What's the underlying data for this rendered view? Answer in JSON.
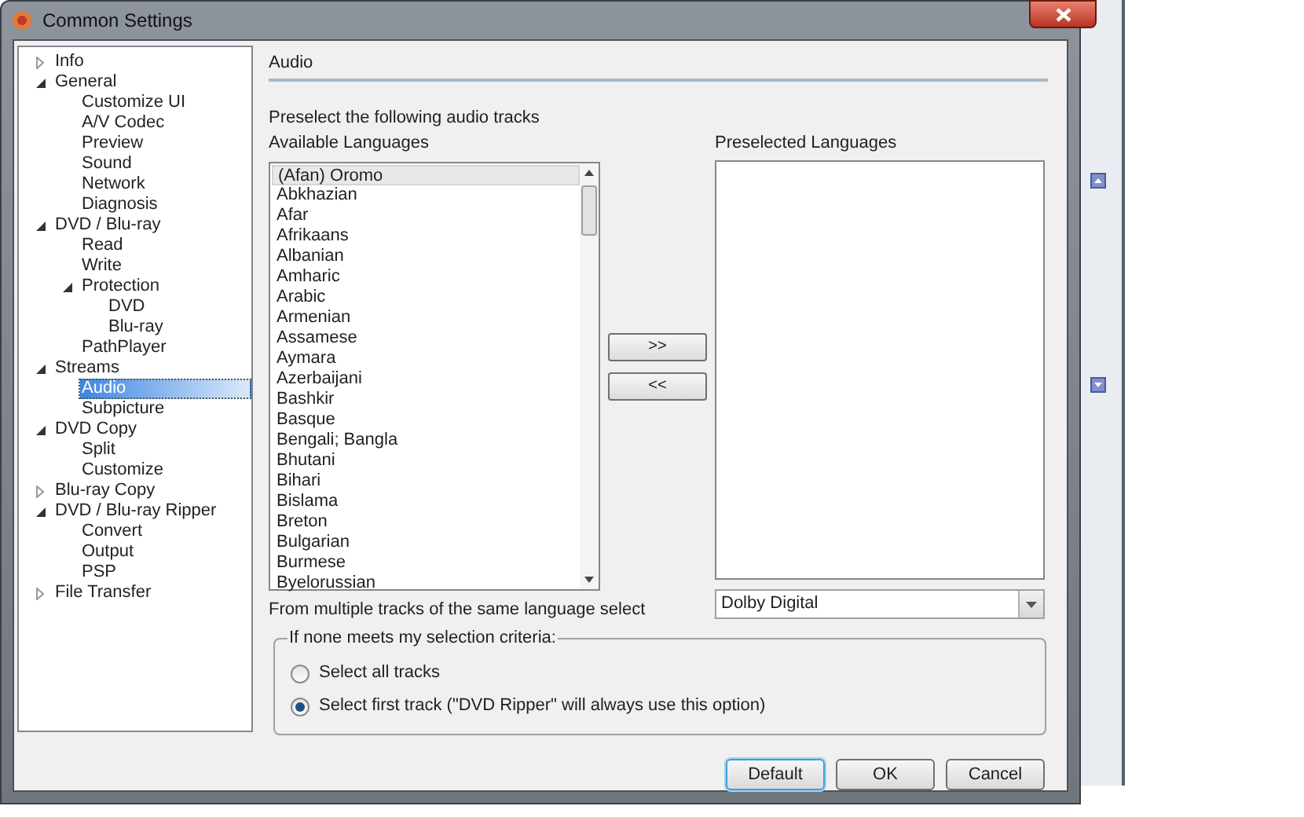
{
  "window": {
    "title": "Common Settings"
  },
  "tree": [
    {
      "label": "Info",
      "expanded": false,
      "selected": false
    },
    {
      "label": "General",
      "expanded": true,
      "selected": false,
      "children": [
        {
          "label": "Customize UI",
          "selected": false
        },
        {
          "label": "A/V Codec",
          "selected": false
        },
        {
          "label": "Preview",
          "selected": false
        },
        {
          "label": "Sound",
          "selected": false
        },
        {
          "label": "Network",
          "selected": false
        },
        {
          "label": "Diagnosis",
          "selected": false
        }
      ]
    },
    {
      "label": "DVD / Blu-ray",
      "expanded": true,
      "selected": false,
      "children": [
        {
          "label": "Read",
          "selected": false
        },
        {
          "label": "Write",
          "selected": false
        },
        {
          "label": "Protection",
          "expanded": true,
          "selected": false,
          "children": [
            {
              "label": "DVD",
              "selected": false
            },
            {
              "label": "Blu-ray",
              "selected": false
            }
          ]
        },
        {
          "label": "PathPlayer",
          "selected": false
        }
      ]
    },
    {
      "label": "Streams",
      "expanded": true,
      "selected": false,
      "children": [
        {
          "label": "Audio",
          "selected": true
        },
        {
          "label": "Subpicture",
          "selected": false
        }
      ]
    },
    {
      "label": "DVD Copy",
      "expanded": true,
      "selected": false,
      "children": [
        {
          "label": "Split",
          "selected": false
        },
        {
          "label": "Customize",
          "selected": false
        }
      ]
    },
    {
      "label": "Blu-ray Copy",
      "expanded": false,
      "selected": false
    },
    {
      "label": "DVD / Blu-ray Ripper",
      "expanded": true,
      "selected": false,
      "children": [
        {
          "label": "Convert",
          "selected": false
        },
        {
          "label": "Output",
          "selected": false
        },
        {
          "label": "PSP",
          "selected": false
        }
      ]
    },
    {
      "label": "File Transfer",
      "expanded": false,
      "selected": false
    }
  ],
  "section_title": "Audio",
  "intro": "Preselect the following audio tracks",
  "available": {
    "label": "Available Languages",
    "items": [
      {
        "label": "(Afan) Oromo",
        "selected": true
      },
      {
        "label": "Abkhazian",
        "selected": false
      },
      {
        "label": "Afar",
        "selected": false
      },
      {
        "label": "Afrikaans",
        "selected": false
      },
      {
        "label": "Albanian",
        "selected": false
      },
      {
        "label": "Amharic",
        "selected": false
      },
      {
        "label": "Arabic",
        "selected": false
      },
      {
        "label": "Armenian",
        "selected": false
      },
      {
        "label": "Assamese",
        "selected": false
      },
      {
        "label": "Aymara",
        "selected": false
      },
      {
        "label": "Azerbaijani",
        "selected": false
      },
      {
        "label": "Bashkir",
        "selected": false
      },
      {
        "label": "Basque",
        "selected": false
      },
      {
        "label": "Bengali; Bangla",
        "selected": false
      },
      {
        "label": "Bhutani",
        "selected": false
      },
      {
        "label": "Bihari",
        "selected": false
      },
      {
        "label": "Bislama",
        "selected": false
      },
      {
        "label": "Breton",
        "selected": false
      },
      {
        "label": "Bulgarian",
        "selected": false
      },
      {
        "label": "Burmese",
        "selected": false
      },
      {
        "label": "Byelorussian",
        "selected": false
      }
    ]
  },
  "add_button": ">>",
  "remove_button": "<<",
  "preselected": {
    "label": "Preselected Languages"
  },
  "format_label": "From multiple tracks of the same language select",
  "format_select": {
    "value": "Dolby Digital"
  },
  "fallback": {
    "legend": "If none meets my selection criteria:",
    "options": [
      {
        "label": "Select all tracks",
        "selected": false
      },
      {
        "label": "Select first track (\"DVD Ripper\" will always use this option)",
        "selected": true
      }
    ]
  },
  "buttons": [
    {
      "label": "Default",
      "focused": true
    },
    {
      "label": "OK",
      "focused": false
    },
    {
      "label": "Cancel",
      "focused": false
    }
  ]
}
